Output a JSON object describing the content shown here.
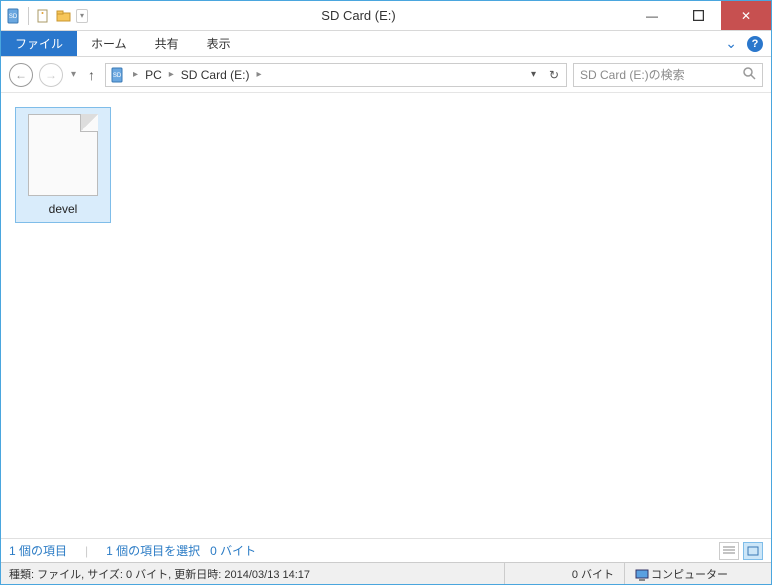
{
  "titlebar": {
    "title": "SD Card (E:)",
    "min_label": "—",
    "max_label": "▢",
    "close_label": "✕"
  },
  "ribbon": {
    "file": "ファイル",
    "home": "ホーム",
    "share": "共有",
    "view": "表示",
    "collapse_glyph": "⌄",
    "help_glyph": "?"
  },
  "nav": {
    "back_glyph": "←",
    "forward_glyph": "→",
    "up_glyph": "↑",
    "history_glyph": "▾",
    "refresh_glyph": "↻",
    "address_drop_glyph": "▾"
  },
  "breadcrumbs": {
    "root": "PC",
    "current": "SD Card (E:)",
    "sep_glyph": "▸"
  },
  "search": {
    "placeholder": "SD Card (E:)の検索",
    "icon_glyph": "🔍"
  },
  "files": [
    {
      "name": "devel"
    }
  ],
  "status1": {
    "items_count": "1 個の項目",
    "selected_count": "1 個の項目を選択",
    "selected_size": "0 バイト"
  },
  "status2": {
    "details": "種類: ファイル, サイズ: 0 バイト, 更新日時: 2014/03/13 14:17",
    "size": "0 バイト",
    "location": "コンピューター"
  },
  "icons": {
    "sd_text": "SD",
    "folder_glyph": "▮",
    "newdoc_glyph": "▫",
    "qat_drop": "▾"
  }
}
